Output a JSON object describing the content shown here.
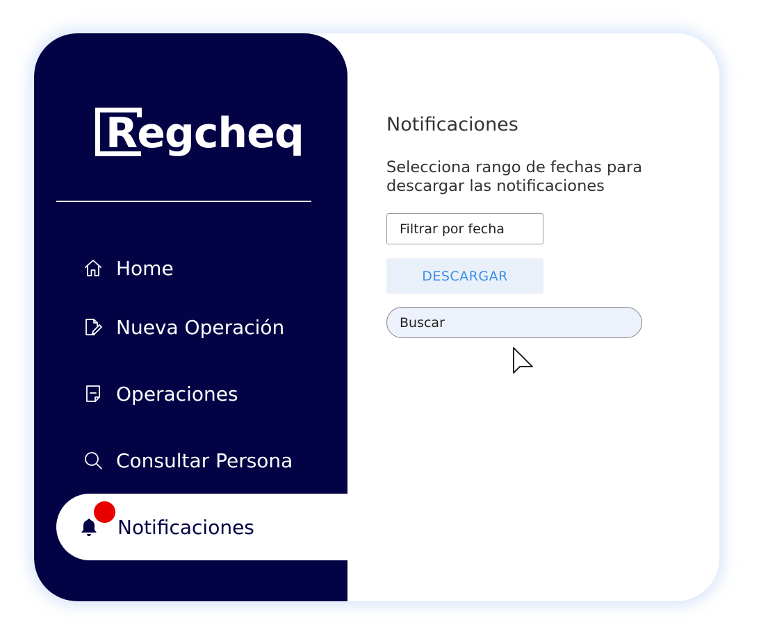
{
  "brand": {
    "logo_text": "Regcheq"
  },
  "sidebar": {
    "items": [
      {
        "label": "Home",
        "icon": "home-icon"
      },
      {
        "label": "Nueva Operación",
        "icon": "edit-document-icon"
      },
      {
        "label": "Operaciones",
        "icon": "document-icon"
      },
      {
        "label": "Consultar Persona",
        "icon": "search-icon"
      },
      {
        "label": "Notificaciones",
        "icon": "bell-icon",
        "active": true,
        "has_badge": true
      }
    ]
  },
  "main": {
    "title": "Notificaciones",
    "description": "Selecciona rango de fechas para descargar las notificaciones",
    "date_filter_label": "Filtrar por fecha",
    "download_label": "DESCARGAR",
    "search_label": "Buscar"
  },
  "colors": {
    "sidebar_bg": "#020244",
    "badge": "#e60000",
    "download_text": "#3a8fe6",
    "download_bg": "#eaf0fa",
    "search_bg": "#edf1fb"
  }
}
